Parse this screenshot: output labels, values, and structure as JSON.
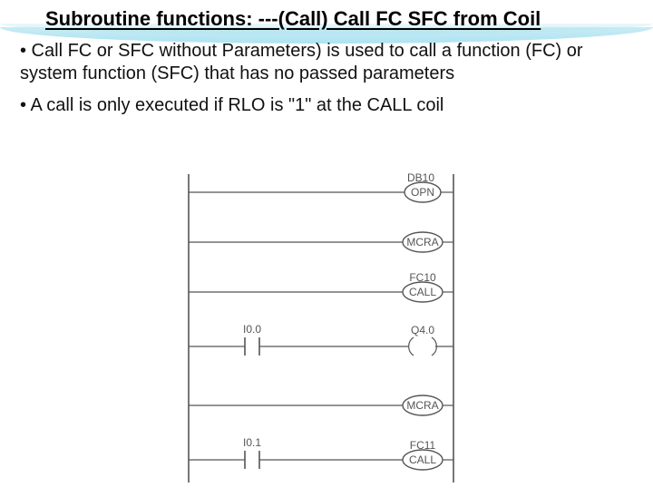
{
  "title": "Subroutine functions: ---(Call) Call FC SFC from Coil",
  "para1": "• Call FC or SFC without Parameters) is used to call a function (FC) or system function (SFC) that has no passed parameters",
  "para2": "• A call is only executed if RLO is \"1\" at the CALL coil",
  "diagram": {
    "rung1": {
      "top": "DB10",
      "coil": "OPN"
    },
    "rung2": {
      "coil": "MCRA"
    },
    "rung3": {
      "top": "FC10",
      "coil": "CALL"
    },
    "rung4": {
      "left": "I0.0",
      "right": "Q4.0"
    },
    "rung5": {
      "coil": "MCRA"
    },
    "rung6": {
      "left": "I0.1",
      "top": "FC11",
      "coil": "CALL"
    }
  }
}
